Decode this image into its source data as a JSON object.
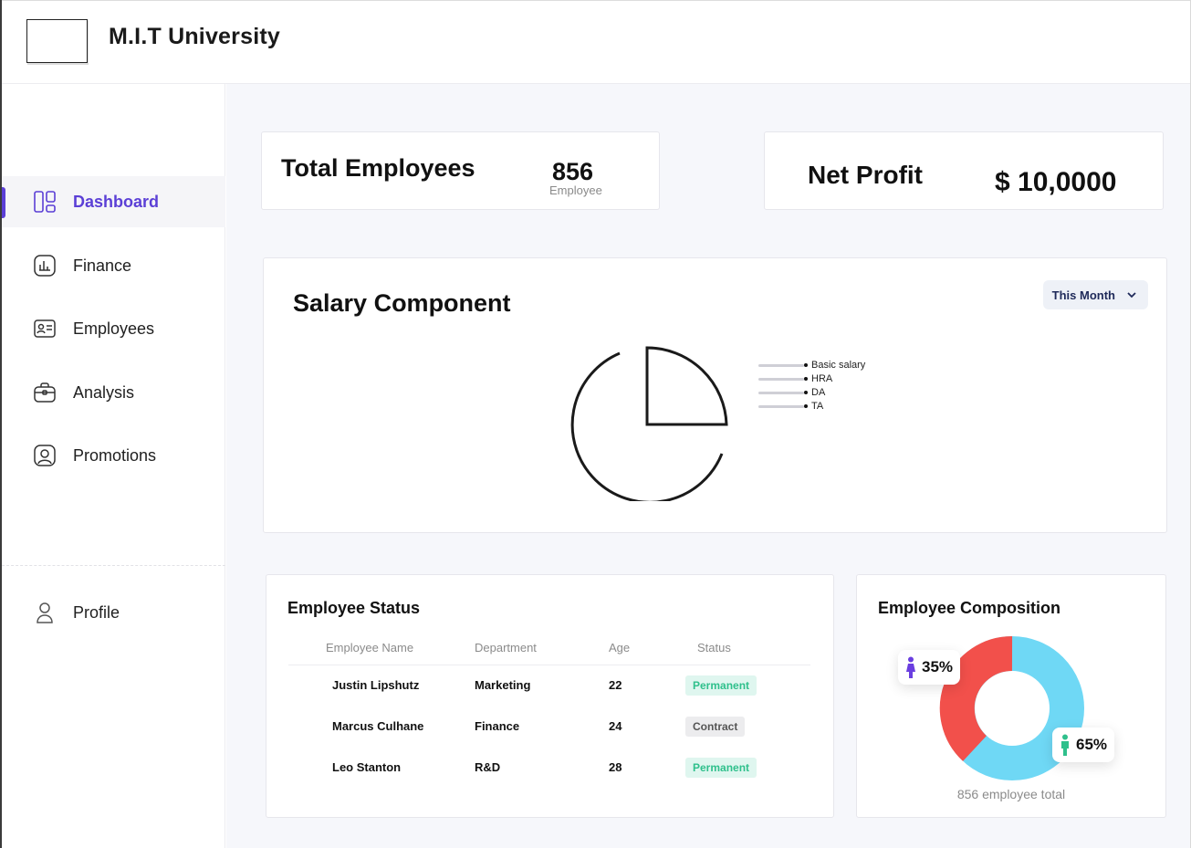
{
  "app": {
    "title": "M.I.T University"
  },
  "sidebar": {
    "items": [
      {
        "label": "Dashboard",
        "icon": "dashboard-icon",
        "active": true
      },
      {
        "label": "Finance",
        "icon": "finance-chart-icon",
        "active": false
      },
      {
        "label": "Employees",
        "icon": "id-card-icon",
        "active": false
      },
      {
        "label": "Analysis",
        "icon": "briefcase-icon",
        "active": false
      },
      {
        "label": "Promotions",
        "icon": "user-badge-icon",
        "active": false
      }
    ],
    "profile": {
      "label": "Profile",
      "icon": "user-icon"
    },
    "accent": "#5b3fd6"
  },
  "stats": {
    "total_employees": {
      "title": "Total Employees",
      "value": "856",
      "sub": "Employee"
    },
    "net_profit": {
      "title": "Net Profit",
      "value": "$ 10,0000"
    }
  },
  "salary": {
    "title": "Salary Component",
    "period": "This Month",
    "legend": [
      "Basic salary",
      "HRA",
      "DA",
      "TA"
    ]
  },
  "employee_status": {
    "title": "Employee Status",
    "columns": [
      "Employee Name",
      "Department",
      "Age",
      "Status"
    ],
    "rows": [
      {
        "name": "Justin Lipshutz",
        "department": "Marketing",
        "age": "22",
        "status": "Permanent"
      },
      {
        "name": "Marcus Culhane",
        "department": "Finance",
        "age": "24",
        "status": "Contract"
      },
      {
        "name": "Leo Stanton",
        "department": "R&D",
        "age": "28",
        "status": "Permanent"
      }
    ]
  },
  "composition": {
    "title": "Employee Composition",
    "female_pct": "35%",
    "male_pct": "65%",
    "footer": "856 employee total",
    "colors": {
      "female": "#f2504b",
      "male": "#6fd8f5",
      "female_icon": "#6a3ee0",
      "male_icon": "#2fc08c"
    }
  }
}
